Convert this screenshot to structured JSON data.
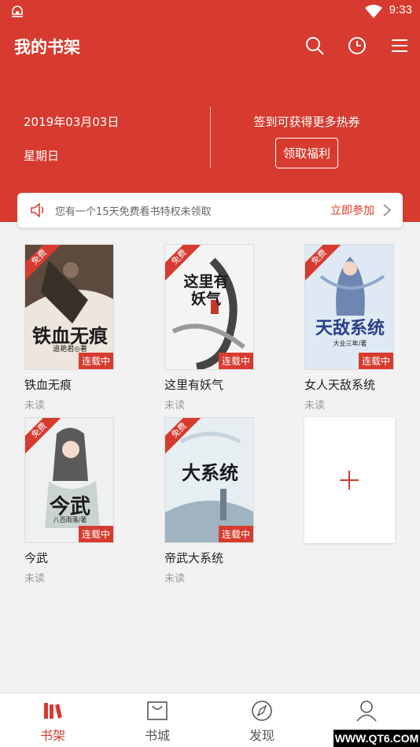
{
  "status_bar": {
    "time": "9:33"
  },
  "header": {
    "title": "我的书架",
    "date": "2019年03月03日",
    "weekday": "星期日",
    "checkin_text": "签到可获得更多热券",
    "checkin_button": "领取福利"
  },
  "promo": {
    "text": "您有一个15天免费看书特权未领取",
    "link": "立即参加"
  },
  "labels": {
    "free": "免费",
    "serializing": "连载中"
  },
  "books": [
    {
      "name": "铁血无痕",
      "status": "未读",
      "cover_title": "铁血无痕",
      "cover_author": "追艳君◎著",
      "cover_color": "#7b6a58"
    },
    {
      "name": "这里有妖气",
      "status": "未读",
      "cover_title": "这里有妖气",
      "cover_author": "",
      "cover_color": "#c9c9c9"
    },
    {
      "name": "女人天敌系统",
      "status": "未读",
      "cover_title": "天敌系统",
      "cover_author": "大业三年/著",
      "cover_color": "#a9c2dc"
    },
    {
      "name": "今武",
      "status": "未读",
      "cover_title": "今武",
      "cover_author": "八百雨落/著",
      "cover_color": "#cfd8d5"
    },
    {
      "name": "帝武大系统",
      "status": "未读",
      "cover_title": "大系统",
      "cover_author": "",
      "cover_color": "#b9cbd6"
    }
  ],
  "tabs": [
    {
      "label": "书架",
      "icon": "bookshelf-icon",
      "active": true
    },
    {
      "label": "书城",
      "icon": "bag-icon",
      "active": false
    },
    {
      "label": "发现",
      "icon": "compass-icon",
      "active": false
    },
    {
      "label": "我的",
      "icon": "person-icon",
      "active": false
    }
  ],
  "watermark": "WWW.QT6.COM",
  "colors": {
    "accent": "#d73b2f"
  }
}
